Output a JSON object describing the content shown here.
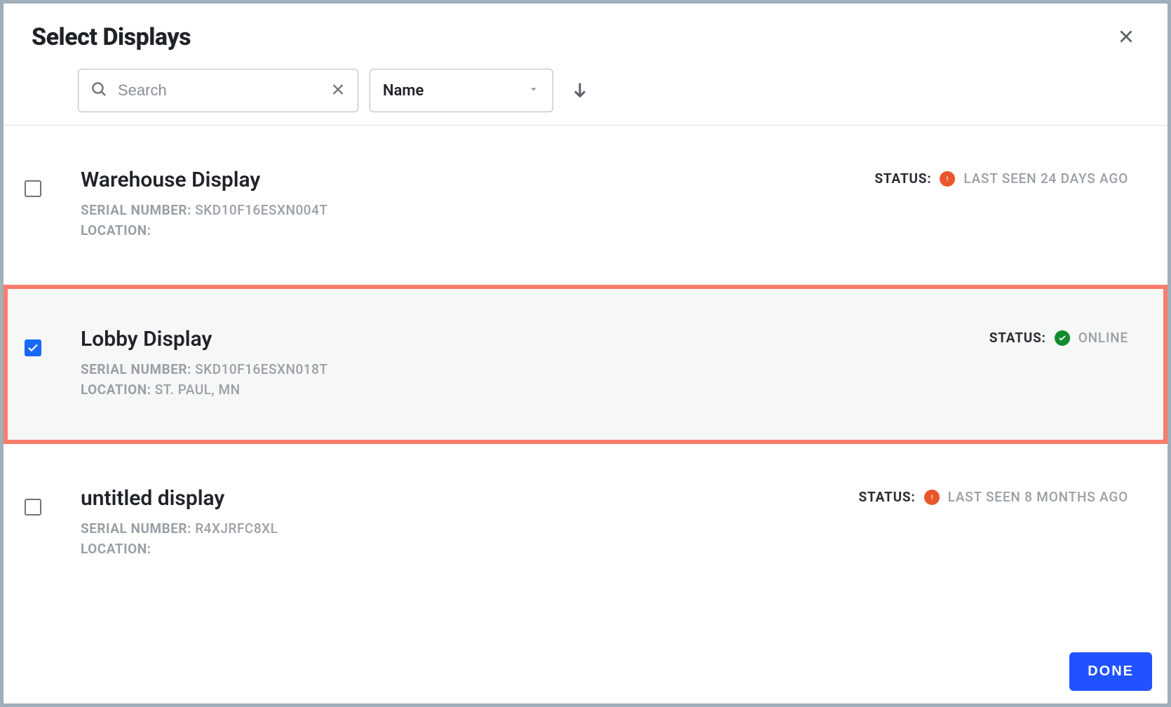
{
  "header": {
    "title": "Select Displays"
  },
  "toolbar": {
    "search_placeholder": "Search",
    "search_value": "",
    "sort_label": "Name"
  },
  "labels": {
    "serial": "SERIAL NUMBER:",
    "location": "LOCATION:",
    "status": "STATUS:"
  },
  "rows": [
    {
      "title": "Warehouse Display",
      "serial": "SKD10F16ESXN004T",
      "location": "",
      "status_kind": "warn",
      "status_text": "LAST SEEN 24 DAYS AGO",
      "checked": false,
      "highlighted": false
    },
    {
      "title": "Lobby Display",
      "serial": "SKD10F16ESXN018T",
      "location": "ST. PAUL, MN",
      "status_kind": "ok",
      "status_text": "ONLINE",
      "checked": true,
      "highlighted": true
    },
    {
      "title": "untitled display",
      "serial": "R4XJRFC8XL",
      "location": "",
      "status_kind": "warn",
      "status_text": "LAST SEEN 8 MONTHS AGO",
      "checked": false,
      "highlighted": false
    }
  ],
  "footer": {
    "done_label": "DONE"
  }
}
